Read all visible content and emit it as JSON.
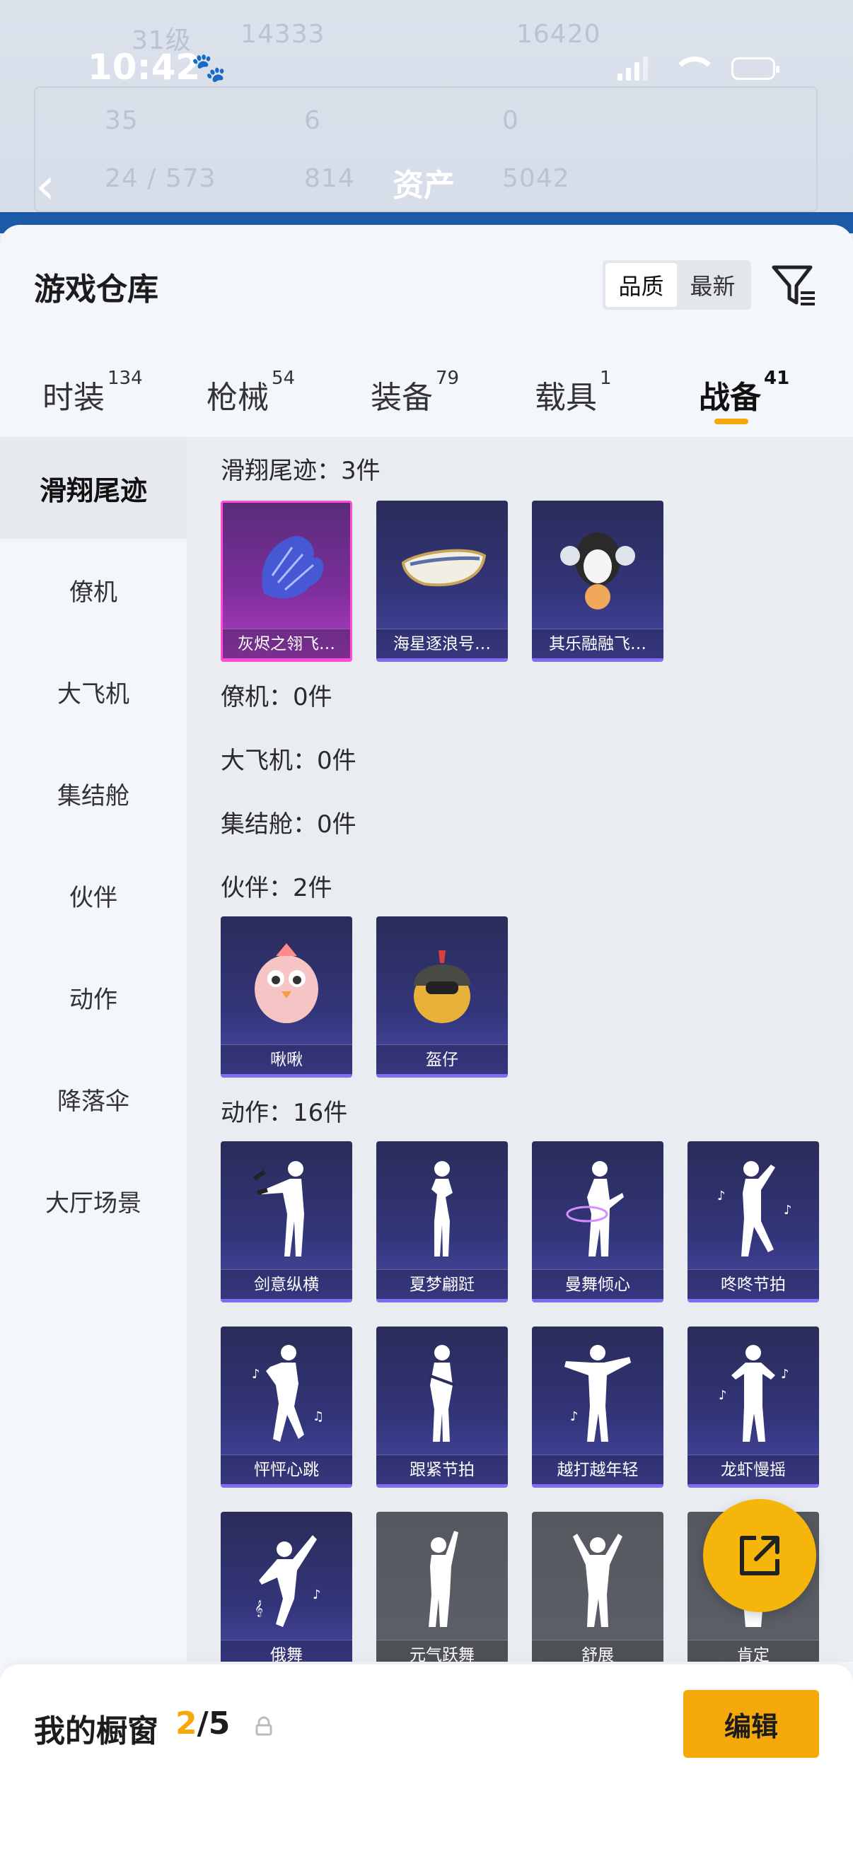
{
  "status_bar": {
    "time": "10:42"
  },
  "background": {
    "title": "资产",
    "ghost_numbers": [
      "31级",
      "14333",
      "16420",
      "35",
      "6",
      "0",
      "24 / 573",
      "814",
      "5042"
    ]
  },
  "header": {
    "title": "游戏仓库",
    "sort_options": [
      "品质",
      "最新"
    ],
    "active_sort": "品质"
  },
  "tabs": [
    {
      "label": "时装",
      "count": "134"
    },
    {
      "label": "枪械",
      "count": "54"
    },
    {
      "label": "装备",
      "count": "79"
    },
    {
      "label": "载具",
      "count": "1"
    },
    {
      "label": "战备",
      "count": "41",
      "active": true
    }
  ],
  "sidebar": {
    "items": [
      "滑翔尾迹",
      "僚机",
      "大飞机",
      "集结舱",
      "伙伴",
      "动作",
      "降落伞",
      "大厅场景"
    ],
    "active": "滑翔尾迹"
  },
  "sections": [
    {
      "title": "滑翔尾迹：3件",
      "items": [
        "灰烬之翎飞…",
        "海星逐浪号…",
        "其乐融融飞…"
      ]
    },
    {
      "title": "僚机：0件",
      "items": []
    },
    {
      "title": "大飞机：0件",
      "items": []
    },
    {
      "title": "集结舱：0件",
      "items": []
    },
    {
      "title": "伙伴：2件",
      "items": [
        "啾啾",
        "盔仔"
      ]
    },
    {
      "title": "动作：16件",
      "items": [
        "剑意纵横",
        "夏梦翩跹",
        "曼舞倾心",
        "咚咚节拍",
        "怦怦心跳",
        "跟紧节拍",
        "越打越年轻",
        "龙虾慢摇",
        "俄舞",
        "元气跃舞",
        "舒展",
        "肯定"
      ]
    }
  ],
  "bottom_bar": {
    "label": "我的橱窗",
    "used": "2",
    "total": "/5",
    "edit_label": "编辑"
  },
  "colors": {
    "accent": "#f5a80a",
    "card_purple": "#33357a",
    "card_pink": "#ff4fd0",
    "card_grey": "#5d6068"
  }
}
